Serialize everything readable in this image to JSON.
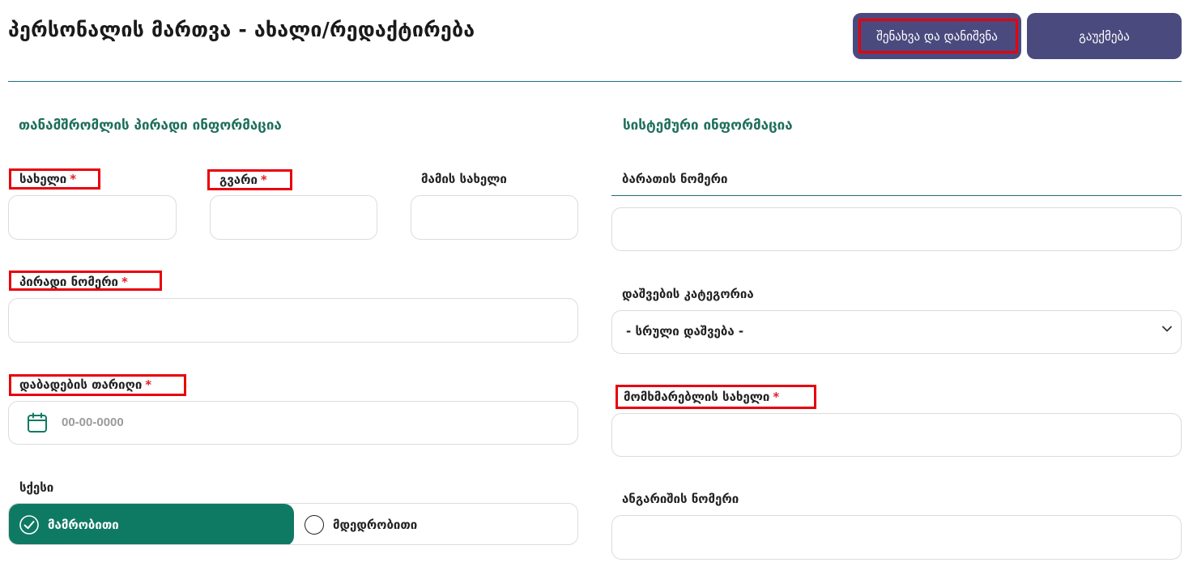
{
  "header": {
    "title": "პერსონალის მართვა - ახალი/რედაქტირება",
    "save_label": "შენახვა და დანიშვნა",
    "cancel_label": "გაუქმება"
  },
  "personal": {
    "section_title": "თანამშრომლის პირადი ინფორმაცია",
    "first_name_label": "სახელი",
    "last_name_label": "გვარი",
    "father_name_label": "მამის სახელი",
    "personal_id_label": "პირადი ნომერი",
    "birth_date_label": "დაბადების თარიღი",
    "birth_date_placeholder": "00-00-0000",
    "gender_label": "სქესი",
    "gender_options": [
      "მამრობითი",
      "მდედრობითი"
    ],
    "gender_selected": "მამრობითი",
    "required_mark": "*"
  },
  "system": {
    "section_title": "სისტემური ინფორმაცია",
    "card_number_label": "ბარათის ნომერი",
    "employment_category_label": "დაშვების კატეგორია",
    "employment_category_value": "- სრული დაშვება -",
    "username_label": "მომხმარებლის სახელი",
    "account_number_label": "ანგარიშის ნომერი"
  },
  "colors": {
    "primary_button": "#4b4a7f",
    "accent_teal": "#0f7a63",
    "section_title": "#1e6f5c",
    "required": "#e0202a",
    "highlight_box": "#e8000b"
  },
  "icons": {
    "date": "calendar-icon",
    "select": "chevron-down-icon",
    "radio_selected": "check-circle-icon"
  }
}
